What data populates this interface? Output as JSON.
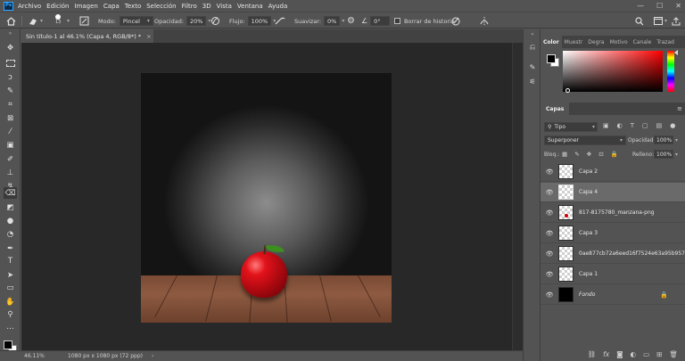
{
  "app": {
    "logo": "Ps"
  },
  "menu": [
    "Archivo",
    "Edición",
    "Imagen",
    "Capa",
    "Texto",
    "Selección",
    "Filtro",
    "3D",
    "Vista",
    "Ventana",
    "Ayuda"
  ],
  "window_controls": {
    "minimize": "—",
    "maximize": "☐",
    "close": "✕"
  },
  "options_bar": {
    "brush_size": "13",
    "mode_label": "Modo:",
    "mode_value": "Pincel",
    "opacity_label": "Opacidad:",
    "opacity_value": "20%",
    "flow_label": "Flujo:",
    "flow_value": "100%",
    "smoothing_label": "Suavizar:",
    "smoothing_value": "0%",
    "angle_value": "0°",
    "erase_history_label": "Borrar de historia"
  },
  "document": {
    "tab_title": "Sin título-1 al 46.1% (Capa 4, RGB/8*) *",
    "tab_close": "×"
  },
  "status_bar": {
    "zoom": "46.11%",
    "dimensions": "1080 px x 1080 px (72 ppp)",
    "arrow": "›"
  },
  "color_panel": {
    "tabs": [
      "Color",
      "Muestr",
      "Degra",
      "Motivo",
      "Canale",
      "Trazad"
    ],
    "foreground": "#000000",
    "background": "#ffffff",
    "hue": "#ff0000"
  },
  "layers_panel": {
    "tab": "Capas",
    "filter_value": "Tipo",
    "blend_mode": "Superponer",
    "opacity_label": "Opacidad:",
    "opacity_value": "100%",
    "lock_label": "Bloq.:",
    "fill_label": "Relleno:",
    "fill_value": "100%",
    "layers": [
      {
        "name": "Capa 2"
      },
      {
        "name": "Capa 4"
      },
      {
        "name": "817-8175780_manzana-png"
      },
      {
        "name": "Capa 3"
      },
      {
        "name": "0ae877cb72a6eed16f7524e63a95b957"
      },
      {
        "name": "Capa 1"
      },
      {
        "name": "Fondo"
      }
    ],
    "selected_layer": "Capa 4"
  },
  "icons": {
    "eye": "👁",
    "lock": "🔒",
    "menu": "≡"
  }
}
